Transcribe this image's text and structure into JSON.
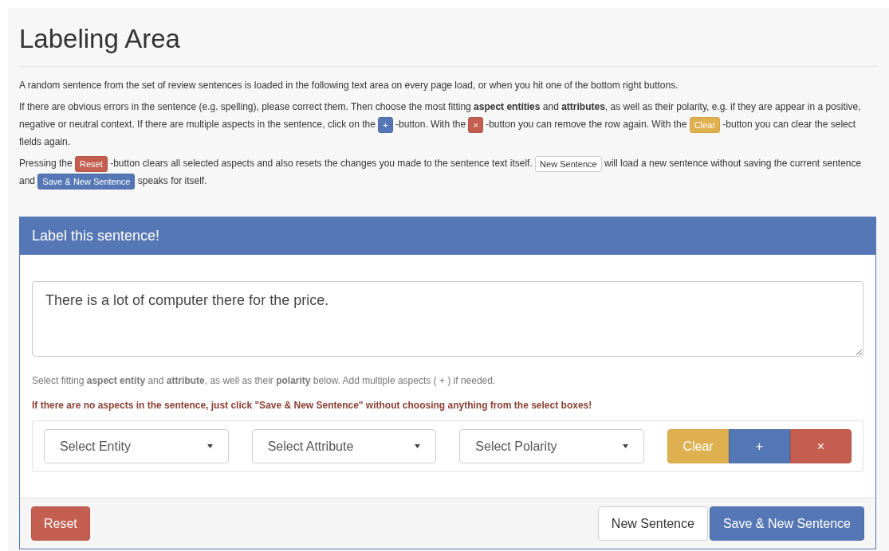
{
  "title": "Labeling Area",
  "intro": [
    [
      {
        "kind": "text",
        "text": "A random sentence from the set of review sentences is loaded in the following text area on every page load, or when you hit one of the bottom right buttons."
      }
    ],
    [
      {
        "kind": "text",
        "text": "If there are obvious errors in the sentence (e.g. spelling), please correct them. Then choose the most fitting **aspect entities** and **attributes**, as well as their polarity, e.g. if they are appear in a positive, negative or neutral context. If there are multiple aspects in the sentence, click on the"
      },
      {
        "kind": "primary",
        "text": "+"
      },
      {
        "kind": "text",
        "text": "-button. With the"
      },
      {
        "kind": "danger",
        "text": "×"
      },
      {
        "kind": "text",
        "text": "-button you can remove the row again. With the"
      },
      {
        "kind": "warning",
        "text": "Clear"
      },
      {
        "kind": "text",
        "text": "-button you can clear the select fields again."
      }
    ],
    [
      {
        "kind": "text",
        "text": "Pressing the"
      },
      {
        "kind": "danger",
        "text": "Reset"
      },
      {
        "kind": "text",
        "text": "-button clears all selected aspects and also resets the changes you made to the sentence text itself."
      },
      {
        "kind": "default",
        "text": "New Sentence"
      },
      {
        "kind": "text",
        "text": "will load a new sentence without saving the current sentence and"
      },
      {
        "kind": "primary",
        "text": "Save & New Sentence"
      },
      {
        "kind": "text",
        "text": "speaks for itself."
      }
    ]
  ],
  "panel": {
    "title": "Label this sentence!",
    "sentence": "There is a lot of computer there for the price.",
    "help": "Select fitting **aspect entity** and **attribute**, as well as their **polarity** below. Add multiple aspects ( + ) if needed.",
    "warning": "If there are no aspects in the sentence, just click \"Save & New Sentence\" without choosing anything from the select boxes!",
    "selects": [
      {
        "value": "Select Entity"
      },
      {
        "value": "Select Attribute"
      },
      {
        "value": "Select Polarity"
      }
    ],
    "row_buttons": [
      {
        "kind": "warning",
        "text": "Clear"
      },
      {
        "kind": "primary",
        "text": "+"
      },
      {
        "kind": "danger",
        "text": "×"
      }
    ],
    "footer_left": [
      {
        "kind": "danger",
        "text": "Reset"
      }
    ],
    "footer_right": [
      {
        "kind": "default",
        "text": "New Sentence"
      },
      {
        "kind": "primary",
        "text": "Save & New Sentence"
      }
    ]
  }
}
